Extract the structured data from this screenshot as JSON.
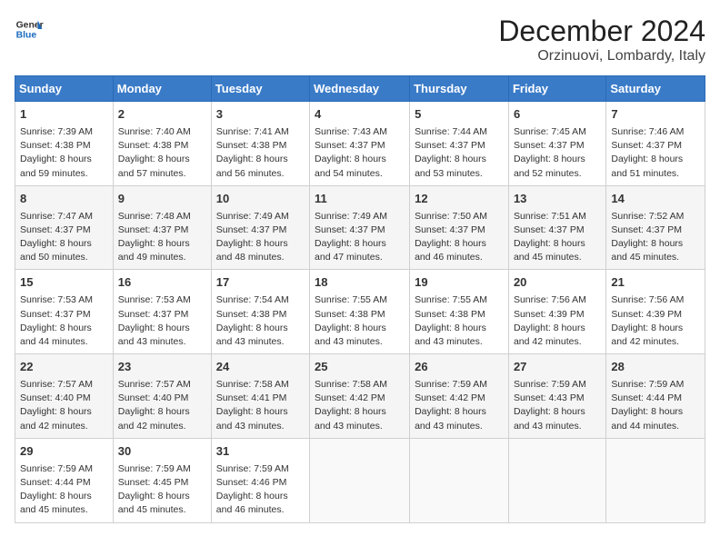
{
  "header": {
    "logo_line1": "General",
    "logo_line2": "Blue",
    "month_title": "December 2024",
    "location": "Orzinuovi, Lombardy, Italy"
  },
  "weekdays": [
    "Sunday",
    "Monday",
    "Tuesday",
    "Wednesday",
    "Thursday",
    "Friday",
    "Saturday"
  ],
  "weeks": [
    [
      {
        "day": "1",
        "sunrise": "Sunrise: 7:39 AM",
        "sunset": "Sunset: 4:38 PM",
        "daylight": "Daylight: 8 hours and 59 minutes."
      },
      {
        "day": "2",
        "sunrise": "Sunrise: 7:40 AM",
        "sunset": "Sunset: 4:38 PM",
        "daylight": "Daylight: 8 hours and 57 minutes."
      },
      {
        "day": "3",
        "sunrise": "Sunrise: 7:41 AM",
        "sunset": "Sunset: 4:38 PM",
        "daylight": "Daylight: 8 hours and 56 minutes."
      },
      {
        "day": "4",
        "sunrise": "Sunrise: 7:43 AM",
        "sunset": "Sunset: 4:37 PM",
        "daylight": "Daylight: 8 hours and 54 minutes."
      },
      {
        "day": "5",
        "sunrise": "Sunrise: 7:44 AM",
        "sunset": "Sunset: 4:37 PM",
        "daylight": "Daylight: 8 hours and 53 minutes."
      },
      {
        "day": "6",
        "sunrise": "Sunrise: 7:45 AM",
        "sunset": "Sunset: 4:37 PM",
        "daylight": "Daylight: 8 hours and 52 minutes."
      },
      {
        "day": "7",
        "sunrise": "Sunrise: 7:46 AM",
        "sunset": "Sunset: 4:37 PM",
        "daylight": "Daylight: 8 hours and 51 minutes."
      }
    ],
    [
      {
        "day": "8",
        "sunrise": "Sunrise: 7:47 AM",
        "sunset": "Sunset: 4:37 PM",
        "daylight": "Daylight: 8 hours and 50 minutes."
      },
      {
        "day": "9",
        "sunrise": "Sunrise: 7:48 AM",
        "sunset": "Sunset: 4:37 PM",
        "daylight": "Daylight: 8 hours and 49 minutes."
      },
      {
        "day": "10",
        "sunrise": "Sunrise: 7:49 AM",
        "sunset": "Sunset: 4:37 PM",
        "daylight": "Daylight: 8 hours and 48 minutes."
      },
      {
        "day": "11",
        "sunrise": "Sunrise: 7:49 AM",
        "sunset": "Sunset: 4:37 PM",
        "daylight": "Daylight: 8 hours and 47 minutes."
      },
      {
        "day": "12",
        "sunrise": "Sunrise: 7:50 AM",
        "sunset": "Sunset: 4:37 PM",
        "daylight": "Daylight: 8 hours and 46 minutes."
      },
      {
        "day": "13",
        "sunrise": "Sunrise: 7:51 AM",
        "sunset": "Sunset: 4:37 PM",
        "daylight": "Daylight: 8 hours and 45 minutes."
      },
      {
        "day": "14",
        "sunrise": "Sunrise: 7:52 AM",
        "sunset": "Sunset: 4:37 PM",
        "daylight": "Daylight: 8 hours and 45 minutes."
      }
    ],
    [
      {
        "day": "15",
        "sunrise": "Sunrise: 7:53 AM",
        "sunset": "Sunset: 4:37 PM",
        "daylight": "Daylight: 8 hours and 44 minutes."
      },
      {
        "day": "16",
        "sunrise": "Sunrise: 7:53 AM",
        "sunset": "Sunset: 4:37 PM",
        "daylight": "Daylight: 8 hours and 43 minutes."
      },
      {
        "day": "17",
        "sunrise": "Sunrise: 7:54 AM",
        "sunset": "Sunset: 4:38 PM",
        "daylight": "Daylight: 8 hours and 43 minutes."
      },
      {
        "day": "18",
        "sunrise": "Sunrise: 7:55 AM",
        "sunset": "Sunset: 4:38 PM",
        "daylight": "Daylight: 8 hours and 43 minutes."
      },
      {
        "day": "19",
        "sunrise": "Sunrise: 7:55 AM",
        "sunset": "Sunset: 4:38 PM",
        "daylight": "Daylight: 8 hours and 43 minutes."
      },
      {
        "day": "20",
        "sunrise": "Sunrise: 7:56 AM",
        "sunset": "Sunset: 4:39 PM",
        "daylight": "Daylight: 8 hours and 42 minutes."
      },
      {
        "day": "21",
        "sunrise": "Sunrise: 7:56 AM",
        "sunset": "Sunset: 4:39 PM",
        "daylight": "Daylight: 8 hours and 42 minutes."
      }
    ],
    [
      {
        "day": "22",
        "sunrise": "Sunrise: 7:57 AM",
        "sunset": "Sunset: 4:40 PM",
        "daylight": "Daylight: 8 hours and 42 minutes."
      },
      {
        "day": "23",
        "sunrise": "Sunrise: 7:57 AM",
        "sunset": "Sunset: 4:40 PM",
        "daylight": "Daylight: 8 hours and 42 minutes."
      },
      {
        "day": "24",
        "sunrise": "Sunrise: 7:58 AM",
        "sunset": "Sunset: 4:41 PM",
        "daylight": "Daylight: 8 hours and 43 minutes."
      },
      {
        "day": "25",
        "sunrise": "Sunrise: 7:58 AM",
        "sunset": "Sunset: 4:42 PM",
        "daylight": "Daylight: 8 hours and 43 minutes."
      },
      {
        "day": "26",
        "sunrise": "Sunrise: 7:59 AM",
        "sunset": "Sunset: 4:42 PM",
        "daylight": "Daylight: 8 hours and 43 minutes."
      },
      {
        "day": "27",
        "sunrise": "Sunrise: 7:59 AM",
        "sunset": "Sunset: 4:43 PM",
        "daylight": "Daylight: 8 hours and 43 minutes."
      },
      {
        "day": "28",
        "sunrise": "Sunrise: 7:59 AM",
        "sunset": "Sunset: 4:44 PM",
        "daylight": "Daylight: 8 hours and 44 minutes."
      }
    ],
    [
      {
        "day": "29",
        "sunrise": "Sunrise: 7:59 AM",
        "sunset": "Sunset: 4:44 PM",
        "daylight": "Daylight: 8 hours and 45 minutes."
      },
      {
        "day": "30",
        "sunrise": "Sunrise: 7:59 AM",
        "sunset": "Sunset: 4:45 PM",
        "daylight": "Daylight: 8 hours and 45 minutes."
      },
      {
        "day": "31",
        "sunrise": "Sunrise: 7:59 AM",
        "sunset": "Sunset: 4:46 PM",
        "daylight": "Daylight: 8 hours and 46 minutes."
      },
      null,
      null,
      null,
      null
    ]
  ]
}
